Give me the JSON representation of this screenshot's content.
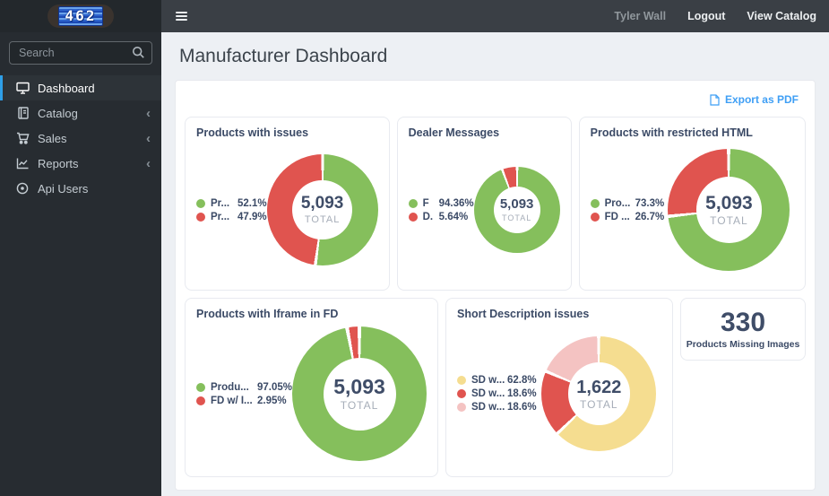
{
  "logo_text": "462",
  "navbar": {
    "user_name": "Tyler Wall",
    "logout_label": "Logout",
    "view_catalog_label": "View Catalog"
  },
  "sidebar": {
    "search_placeholder": "Search",
    "items": [
      {
        "label": "Dashboard",
        "icon": "desktop-icon",
        "active": true,
        "has_submenu": false
      },
      {
        "label": "Catalog",
        "icon": "book-icon",
        "active": false,
        "has_submenu": true
      },
      {
        "label": "Sales",
        "icon": "cart-icon",
        "active": false,
        "has_submenu": true
      },
      {
        "label": "Reports",
        "icon": "line-chart-icon",
        "active": false,
        "has_submenu": true
      },
      {
        "label": "Api Users",
        "icon": "dot-circle-icon",
        "active": false,
        "has_submenu": false
      }
    ]
  },
  "page": {
    "title": "Manufacturer Dashboard",
    "export_label": "Export as PDF"
  },
  "stat_card": {
    "value": "330",
    "label": "Products Missing Images"
  },
  "colors": {
    "green": "#85bf5c",
    "red": "#e0544f",
    "yellow": "#f5dd90",
    "pink": "#f4c3c2",
    "accent_blue": "#3f9ff5"
  },
  "chart_data": [
    {
      "type": "pie",
      "shape": "donut",
      "size": 124,
      "title": "Products with issues",
      "total": "5,093",
      "total_label": "TOTAL",
      "legend_position": "left",
      "series": [
        {
          "name": "Pr...",
          "pct": "52.1%",
          "value": 52.1,
          "color": "#85bf5c"
        },
        {
          "name": "Pr...",
          "pct": "47.9%",
          "value": 47.9,
          "color": "#e0544f"
        }
      ]
    },
    {
      "type": "pie",
      "shape": "donut",
      "size": 96,
      "title": "Dealer Messages",
      "total": "5,093",
      "total_label": "TOTAL",
      "legend_position": "left",
      "series": [
        {
          "name": "F",
          "pct": "94.36%",
          "value": 94.36,
          "color": "#85bf5c"
        },
        {
          "name": "D.",
          "pct": "5.64%",
          "value": 5.64,
          "color": "#e0544f"
        }
      ]
    },
    {
      "type": "pie",
      "shape": "donut",
      "size": 136,
      "title": "Products with restricted HTML",
      "total": "5,093",
      "total_label": "TOTAL",
      "legend_position": "left",
      "series": [
        {
          "name": "Pro...",
          "pct": "73.3%",
          "value": 73.3,
          "color": "#85bf5c"
        },
        {
          "name": "FD ...",
          "pct": "26.7%",
          "value": 26.7,
          "color": "#e0544f"
        }
      ]
    },
    {
      "type": "pie",
      "shape": "donut",
      "size": 150,
      "title": "Products with Iframe in FD",
      "total": "5,093",
      "total_label": "TOTAL",
      "legend_position": "left",
      "series": [
        {
          "name": "Produ...",
          "pct": "97.05%",
          "value": 97.05,
          "color": "#85bf5c"
        },
        {
          "name": "FD w/ I...",
          "pct": "2.95%",
          "value": 2.95,
          "color": "#e0544f"
        }
      ]
    },
    {
      "type": "pie",
      "shape": "donut",
      "size": 128,
      "title": "Short Description issues",
      "total": "1,622",
      "total_label": "TOTAL",
      "legend_position": "left",
      "series": [
        {
          "name": "SD w...",
          "pct": "62.8%",
          "value": 62.8,
          "color": "#f5dd90"
        },
        {
          "name": "SD w...",
          "pct": "18.6%",
          "value": 18.6,
          "color": "#e0544f"
        },
        {
          "name": "SD w...",
          "pct": "18.6%",
          "value": 18.6,
          "color": "#f4c3c2"
        }
      ]
    }
  ]
}
